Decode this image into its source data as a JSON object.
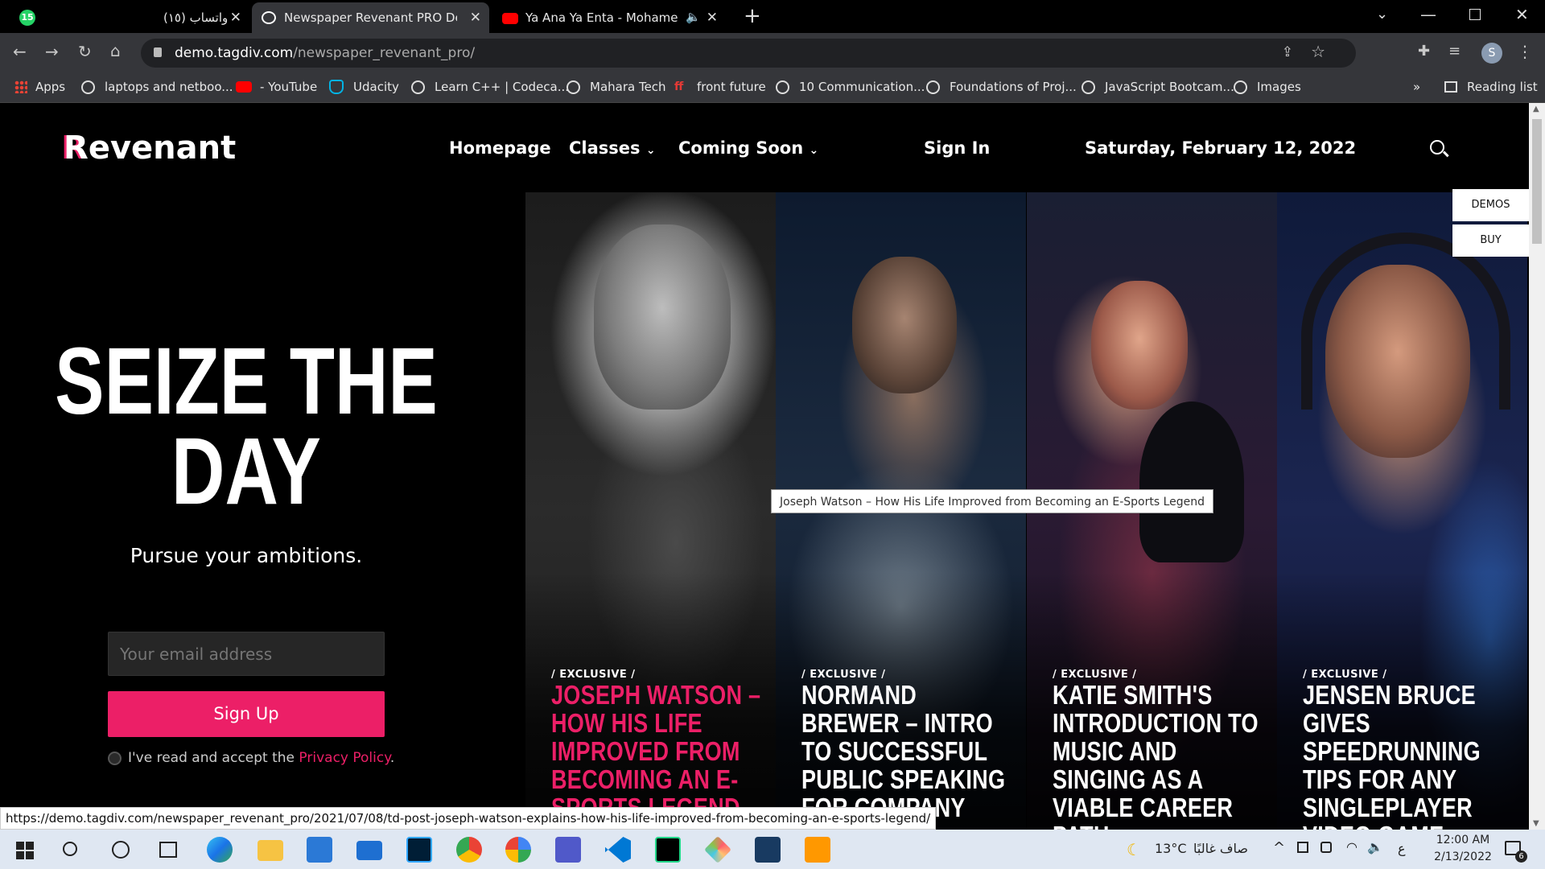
{
  "browser": {
    "tabs": [
      {
        "title": "(١٥) واتساب",
        "badge": "15"
      },
      {
        "title": "Newspaper Revenant PRO Demo"
      },
      {
        "title": "Ya Ana Ya Enta - Mohamed H"
      }
    ],
    "url_domain": "demo.tagdiv.com",
    "url_path": "/newspaper_revenant_pro/",
    "profile_initial": "S",
    "bookmarks": [
      "Apps",
      "laptops and netboo...",
      "- YouTube",
      "Udacity",
      "Learn C++ | Codeca...",
      "Mahara Tech",
      "front future",
      "10 Communication...",
      "Foundations of Proj...",
      "JavaScript Bootcam...",
      "Images"
    ],
    "more_bookmarks": "»",
    "reading_list": "Reading list",
    "status_url": "https://demo.tagdiv.com/newspaper_revenant_pro/2021/07/08/td-post-joseph-watson-explains-how-his-life-improved-from-becoming-an-e-sports-legend/"
  },
  "site": {
    "logo_first": "R",
    "logo_rest": "evenant",
    "nav": {
      "homepage": "Homepage",
      "classes": "Classes",
      "coming_soon": "Coming Soon",
      "sign_in": "Sign In",
      "date": "Saturday, February 12, 2022"
    },
    "side_buttons": {
      "demos": "DEMOS",
      "buy": "BUY"
    },
    "hero": {
      "headline_1": "SEIZE THE",
      "headline_2": "DAY",
      "subtitle": "Pursue your ambitions.",
      "email_placeholder": "Your email address",
      "signup": "Sign Up",
      "consent_text": "I've read and accept the ",
      "consent_link": "Privacy Policy",
      "consent_end": "."
    },
    "tooltip": "Joseph Watson – How His Life Improved from Becoming an E-Sports Legend",
    "cards": [
      {
        "category": "/ EXCLUSIVE /",
        "title": "JOSEPH WATSON – HOW HIS LIFE IMPROVED FROM BECOMING AN E-SPORTS LEGEND",
        "accent": "#ec1f67"
      },
      {
        "category": "/ EXCLUSIVE /",
        "title": "NORMAND BREWER – INTRO TO SUCCESSFUL PUBLIC SPEAKING FOR COMPANY",
        "accent": "#ffffff"
      },
      {
        "category": "/ EXCLUSIVE /",
        "title": "KATIE SMITH'S INTRODUCTION TO MUSIC AND SINGING AS A VIABLE CAREER PATH",
        "accent": "#ffffff"
      },
      {
        "category": "/ EXCLUSIVE /",
        "title": "JENSEN BRUCE GIVES SPEEDRUNNING TIPS FOR ANY SINGLEPLAYER VIDEO GAME",
        "accent": "#ffffff"
      }
    ]
  },
  "taskbar": {
    "weather_temp": "13°C",
    "weather_text": "صاف غالبًا",
    "lang": "ع",
    "time": "12:00 AM",
    "date": "2/13/2022",
    "notif_count": "6"
  },
  "colors": {
    "accent": "#ec1f67",
    "chrome": "#35363a",
    "page_bg": "#000000"
  }
}
